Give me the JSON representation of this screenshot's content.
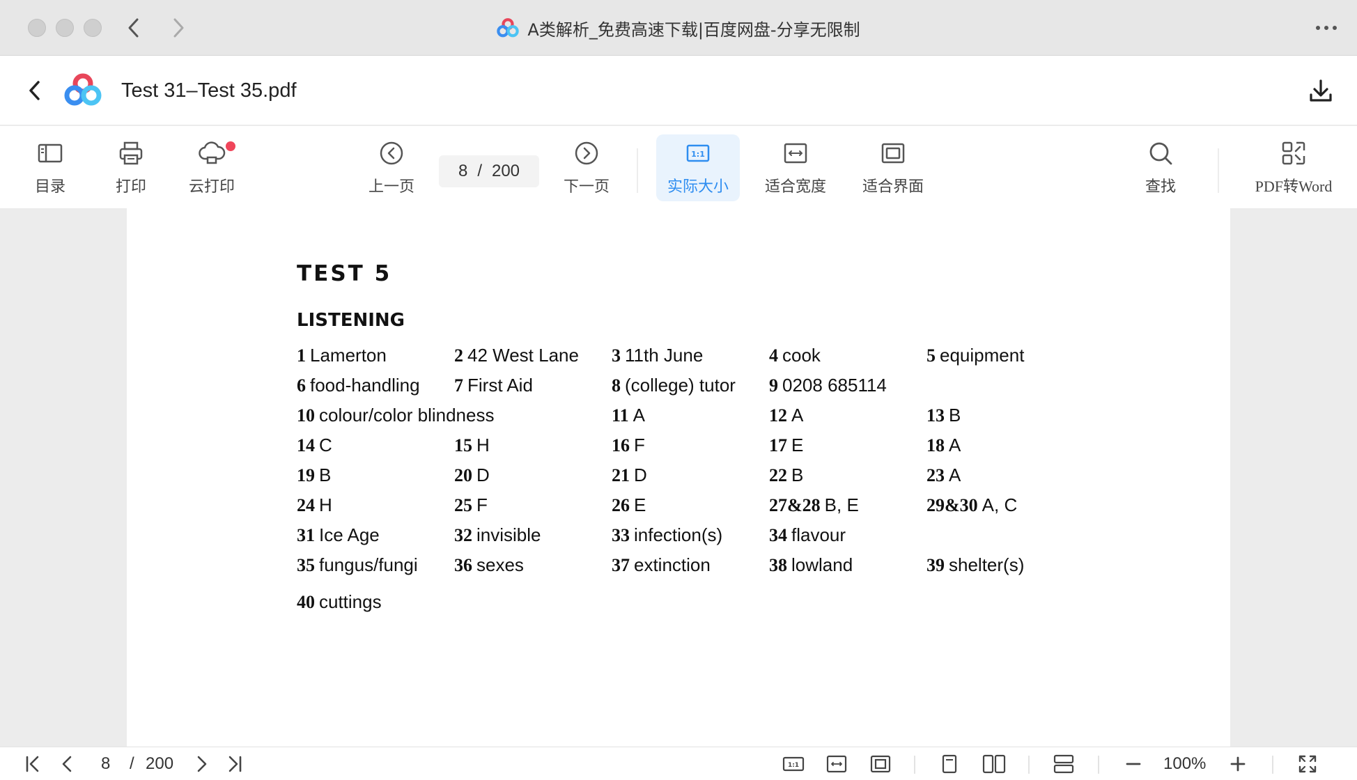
{
  "window": {
    "title": "A类解析_免费高速下载|百度网盘-分享无限制",
    "icons": {
      "back": "chevron-left-icon",
      "forward": "chevron-right-icon",
      "more": "more-horizontal-icon",
      "logo": "baidu-netdisk-logo"
    }
  },
  "header": {
    "file_name": "Test 31–Test 35.pdf",
    "icons": {
      "back": "chevron-left-icon",
      "logo": "baidu-netdisk-logo",
      "download": "download-icon"
    }
  },
  "toolbar": {
    "toc": "目录",
    "print": "打印",
    "cloud_print": "云打印",
    "prev_page": "上一页",
    "current_page": "8",
    "page_separator": "/",
    "total_pages": "200",
    "next_page": "下一页",
    "actual_size": "实际大小",
    "fit_width": "适合宽度",
    "fit_page": "适合界面",
    "search": "查找",
    "pdf_to_word": "PDF转Word",
    "active_tool": "actual_size",
    "accent_color": "#2e8df0",
    "badge_color": "#f0455a"
  },
  "document": {
    "title": "TEST 5",
    "section": "LISTENING",
    "rows": [
      [
        {
          "n": "1",
          "a": "Lamerton"
        },
        {
          "n": "2",
          "a": "42 West Lane"
        },
        {
          "n": "3",
          "a": "11th June"
        },
        {
          "n": "4",
          "a": "cook"
        },
        {
          "n": "5",
          "a": "equipment"
        }
      ],
      [
        {
          "n": "6",
          "a": "food-handling"
        },
        {
          "n": "7",
          "a": "First Aid"
        },
        {
          "n": "8",
          "a": "(college) tutor"
        },
        {
          "n": "9",
          "a": "0208 685114"
        }
      ],
      [
        {
          "n": "10",
          "a": "colour/color blindness",
          "wide": true
        },
        {
          "n": "11",
          "a": "A"
        },
        {
          "n": "12",
          "a": "A"
        },
        {
          "n": "13",
          "a": "B"
        }
      ],
      [
        {
          "n": "14",
          "a": "C"
        },
        {
          "n": "15",
          "a": "H"
        },
        {
          "n": "16",
          "a": "F"
        },
        {
          "n": "17",
          "a": "E"
        },
        {
          "n": "18",
          "a": "A"
        }
      ],
      [
        {
          "n": "19",
          "a": "B"
        },
        {
          "n": "20",
          "a": "D"
        },
        {
          "n": "21",
          "a": "D"
        },
        {
          "n": "22",
          "a": "B"
        },
        {
          "n": "23",
          "a": "A"
        }
      ],
      [
        {
          "n": "24",
          "a": "H"
        },
        {
          "n": "25",
          "a": "F"
        },
        {
          "n": "26",
          "a": "E"
        },
        {
          "n": "27&28",
          "a": "B, E"
        },
        {
          "n": "29&30",
          "a": "A, C"
        }
      ],
      [
        {
          "n": "31",
          "a": "Ice Age"
        },
        {
          "n": "32",
          "a": "invisible"
        },
        {
          "n": "33",
          "a": "infection(s)"
        },
        {
          "n": "34",
          "a": "flavour"
        }
      ],
      [
        {
          "n": "35",
          "a": "fungus/fungi"
        },
        {
          "n": "36",
          "a": "sexes"
        },
        {
          "n": "37",
          "a": "extinction"
        },
        {
          "n": "38",
          "a": "lowland"
        },
        {
          "n": "39",
          "a": "shelter(s)"
        }
      ],
      [
        {
          "n": "40",
          "a": "cuttings"
        }
      ]
    ]
  },
  "statusbar": {
    "current_page": "8",
    "page_separator": "/",
    "total_pages": "200",
    "zoom": "100%",
    "icons": [
      "first-page-icon",
      "prev-page-icon",
      "next-page-icon",
      "last-page-icon",
      "actual-size-icon",
      "fit-width-icon",
      "fit-page-icon",
      "single-page-icon",
      "two-page-icon",
      "continuous-scroll-icon",
      "zoom-out-icon",
      "zoom-in-icon",
      "fullscreen-icon"
    ]
  }
}
